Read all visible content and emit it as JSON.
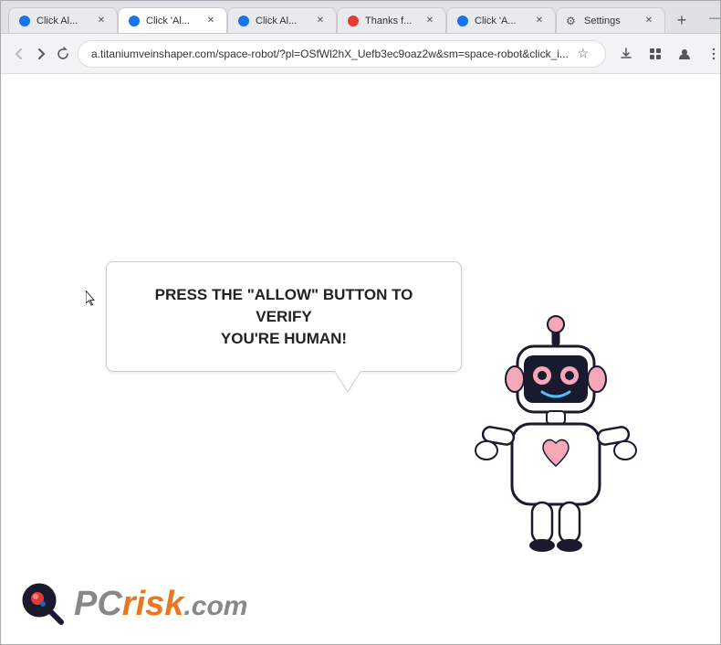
{
  "browser": {
    "tabs": [
      {
        "id": 1,
        "title": "Click Al...",
        "active": false,
        "favicon": "blue"
      },
      {
        "id": 2,
        "title": "Click 'Al...",
        "active": true,
        "favicon": "blue"
      },
      {
        "id": 3,
        "title": "Click Al...",
        "active": false,
        "favicon": "blue"
      },
      {
        "id": 4,
        "title": "Thanks f...",
        "active": false,
        "favicon": "red"
      },
      {
        "id": 5,
        "title": "Click 'A...",
        "active": false,
        "favicon": "blue"
      },
      {
        "id": 6,
        "title": "Settings",
        "active": false,
        "favicon": "gear"
      }
    ],
    "address": "a.titaniumveinshaper.com/space-robot/?pl=OSfWl2hX_Uefb3ec9oaz2w&sm=space-robot&click_i...",
    "window_controls": {
      "minimize": "—",
      "maximize": "□",
      "close": "✕"
    }
  },
  "page": {
    "speech_bubble": {
      "line1": "PRESS THE \"ALLOW\" BUTTON TO VERIFY",
      "line2": "YOU'RE HUMAN!"
    },
    "logo": {
      "pc_text": "PC",
      "risk_text": "risk",
      "com_text": ".com"
    }
  }
}
